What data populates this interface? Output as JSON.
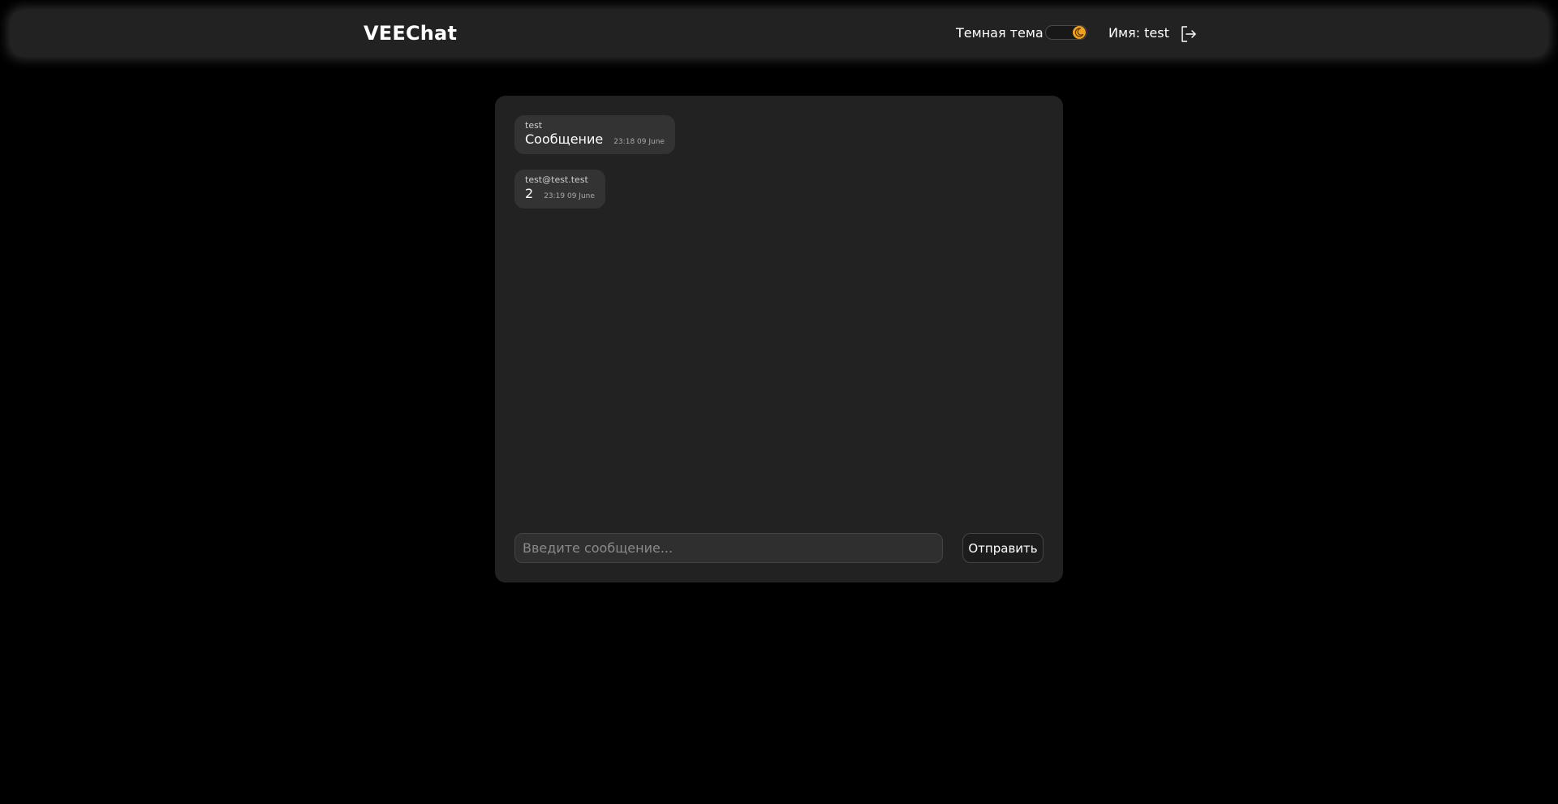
{
  "header": {
    "logo": "VEEChat",
    "theme_label": "Темная тема",
    "user_label": "Имя: test",
    "toggle_icon": "moon-icon",
    "logout_icon": "logout-icon"
  },
  "chat": {
    "messages": [
      {
        "author": "test",
        "text": "Сообщение",
        "time": "23:18 09 June"
      },
      {
        "author": "test@test.test",
        "text": "2",
        "time": "23:19 09 June"
      }
    ],
    "input_placeholder": "Введите сообщение...",
    "send_label": "Отправить"
  },
  "colors": {
    "background": "#000000",
    "panel": "#222222",
    "bubble": "#333333",
    "accent": "#f2a11d"
  }
}
